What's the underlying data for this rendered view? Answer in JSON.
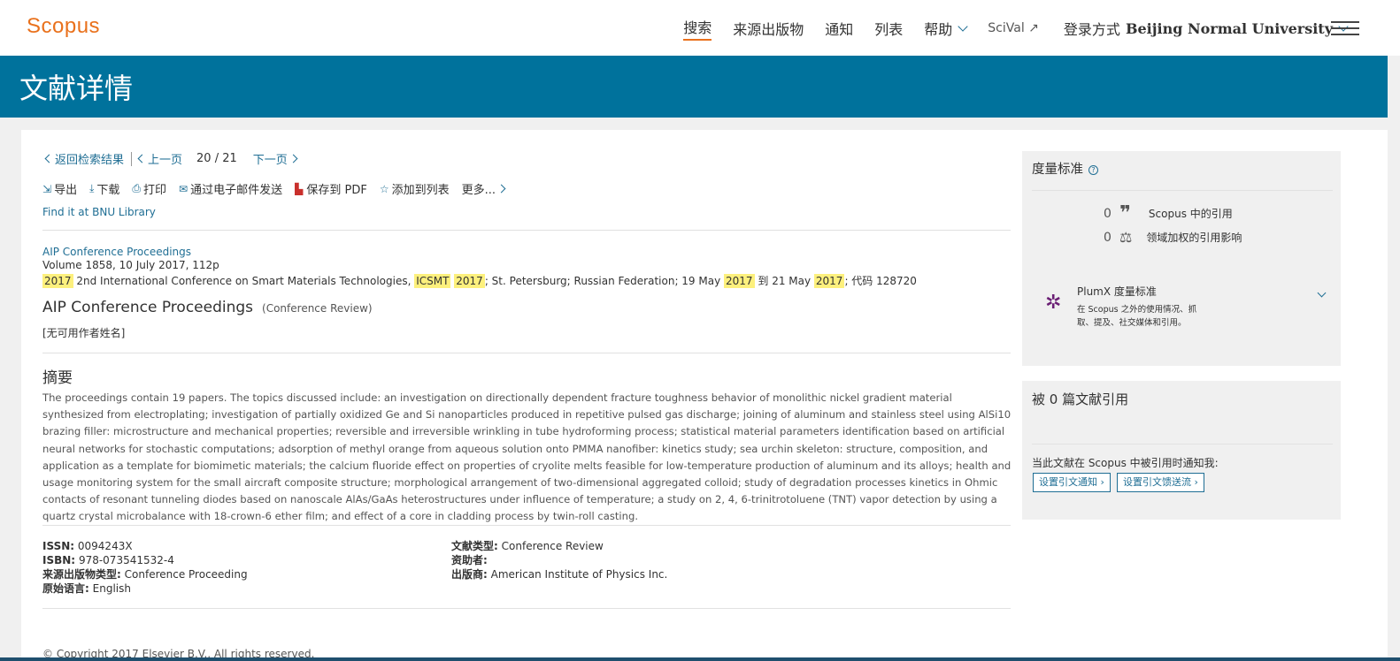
{
  "header": {
    "logo": "Scopus",
    "nav": [
      "搜索",
      "来源出版物",
      "通知",
      "列表",
      "帮助"
    ],
    "scival": "SciVal ↗",
    "login_prefix": "登录方式",
    "login_org": "Beijing Normal University"
  },
  "page_title": "文献详情",
  "breadcrumb": {
    "back": "返回检索结果",
    "prev": "上一页",
    "current": "20",
    "slash": "/",
    "total": "21",
    "next": "下一页"
  },
  "tools": {
    "export": "导出",
    "download": "下载",
    "print": "打印",
    "email": "通过电子邮件发送",
    "pdf": "保存到 PDF",
    "add_list": "添加到列表",
    "more": "更多..."
  },
  "find_library": "Find it at BNU Library",
  "source": {
    "title": "AIP Conference Proceedings",
    "volume": "Volume 1858, 10 July 2017, 112p",
    "conf_parts": {
      "p1": "2017",
      "p2": " 2nd International Conference on Smart Materials Technologies, ",
      "p3": "ICSMT",
      "p4": "2017",
      "p5": "; St. Petersburg; Russian Federation; 19 May ",
      "p6": "2017",
      "p7": " 到 21 May ",
      "p8": "2017",
      "p9": "; 代码 128720"
    }
  },
  "document": {
    "title": "AIP Conference Proceedings",
    "type": "(Conference Review)",
    "no_author": "[无可用作者姓名]"
  },
  "abstract": {
    "heading": "摘要",
    "text": "The proceedings contain 19 papers. The topics discussed include: an investigation on directionally dependent fracture toughness behavior of monolithic nickel gradient material synthesized from electroplating; investigation of partially oxidized Ge and Si nanoparticles produced in repetitive pulsed gas discharge; joining of aluminum and stainless steel using AlSi10 brazing filler: microstructure and mechanical properties; reversible and irreversible wrinkling in tube hydroforming process; statistical material parameters identification based on artificial neural networks for stochastic computations; adsorption of methyl orange from aqueous solution onto PMMA nanofiber: kinetics study; sea urchin skeleton: structure, composition, and application as a template for biomimetic materials; the calcium fluoride effect on properties of cryolite melts feasible for low-temperature production of aluminum and its alloys; health and usage monitoring system for the small aircraft composite structure; morphological arrangement of two-dimensional aggregated colloid; study of degradation processes kinetics in Ohmic contacts of resonant tunneling diodes based on nanoscale AlAs/GaAs heterostructures under influence of temperature; a study on 2, 4, 6-trinitrotoluene (TNT) vapor detection by using a quartz crystal microbalance with 18-crown-6 ether film; and effect of a core in cladding process by twin-roll casting."
  },
  "meta": {
    "issn_k": "ISSN:",
    "issn_v": "0094243X",
    "isbn_k": "ISBN:",
    "isbn_v": "978-073541532-4",
    "srctype_k": "来源出版物类型:",
    "srctype_v": "Conference Proceeding",
    "lang_k": "原始语言:",
    "lang_v": "English",
    "doctype_k": "文献类型:",
    "doctype_v": "Conference Review",
    "funder_k": "资助者:",
    "publisher_k": "出版商:",
    "publisher_v": "American Institute of Physics Inc."
  },
  "copyright": "© Copyright 2017 Elsevier B.V., All rights reserved.",
  "metrics": {
    "heading": "度量标准",
    "citations_count": "0",
    "citations_label": "Scopus 中的引用",
    "fwci_count": "0",
    "fwci_label": "领域加权的引用影响",
    "plumx_title": "PlumX 度量标准",
    "plumx_desc": "在 Scopus 之外的使用情况、抓取、提及、社交媒体和引用。"
  },
  "cited_by": {
    "heading": "被 0 篇文献引用",
    "notify": "当此文献在 Scopus 中被引用时通知我:",
    "btn_alert": "设置引文通知 ›",
    "btn_feed": "设置引文馈送流 ›"
  },
  "colors": {
    "brand": "#e9711c",
    "band": "#00729c",
    "link": "#1f6e94",
    "highlight": "#fdf07d"
  }
}
